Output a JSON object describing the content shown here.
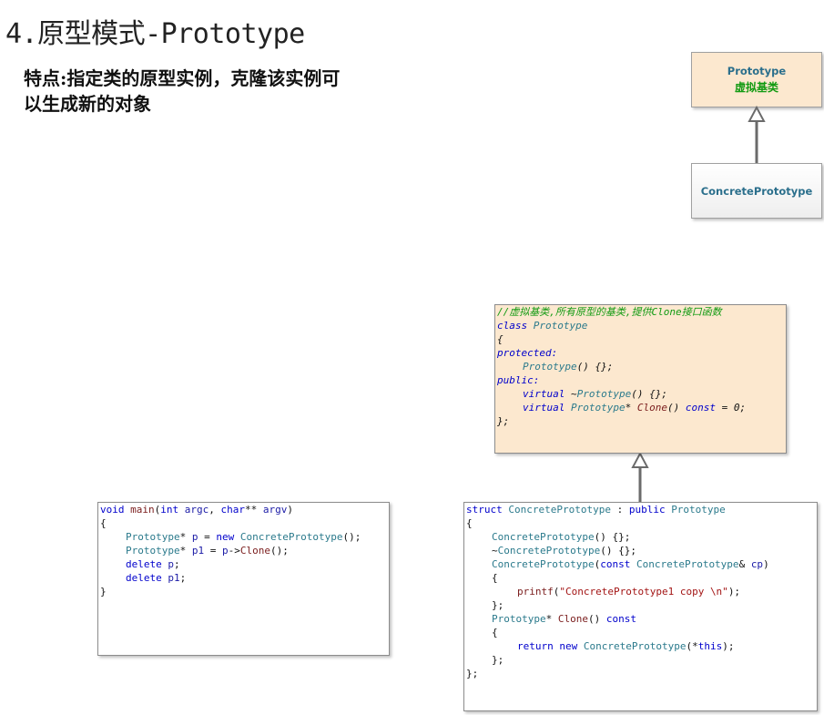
{
  "title": "4.原型模式-Prototype",
  "description": "特点:指定类的原型实例，克隆该实例可以生成新的对象",
  "uml": {
    "prototype": {
      "name": "Prototype",
      "subtitle": "虚拟基类"
    },
    "concrete": {
      "name": "ConcretePrototype"
    }
  },
  "code_declaration": {
    "lines": [
      {
        "tokens": [
          {
            "t": "//虚拟基类,所有原型的基类,提供Clone接口函数",
            "c": "comment"
          }
        ],
        "indent": 0
      },
      {
        "tokens": [
          {
            "t": "class ",
            "c": "kw"
          },
          {
            "t": "Prototype",
            "c": "type"
          }
        ],
        "indent": 0
      },
      {
        "tokens": [
          {
            "t": "{",
            "c": "plain"
          }
        ],
        "indent": 0
      },
      {
        "tokens": [
          {
            "t": "protected:",
            "c": "kw"
          }
        ],
        "indent": 0
      },
      {
        "tokens": [
          {
            "t": "Prototype",
            "c": "type"
          },
          {
            "t": "() {};",
            "c": "plain"
          }
        ],
        "indent": 1
      },
      {
        "tokens": [
          {
            "t": "public:",
            "c": "kw"
          }
        ],
        "indent": 0
      },
      {
        "tokens": [
          {
            "t": "virtual ",
            "c": "kw"
          },
          {
            "t": "~",
            "c": "plain"
          },
          {
            "t": "Prototype",
            "c": "type"
          },
          {
            "t": "() {};",
            "c": "plain"
          }
        ],
        "indent": 1
      },
      {
        "tokens": [
          {
            "t": "virtual ",
            "c": "kw"
          },
          {
            "t": "Prototype",
            "c": "type"
          },
          {
            "t": "* ",
            "c": "plain"
          },
          {
            "t": "Clone",
            "c": "fn"
          },
          {
            "t": "() ",
            "c": "plain"
          },
          {
            "t": "const",
            "c": "kw"
          },
          {
            "t": " = 0;",
            "c": "plain"
          }
        ],
        "indent": 1
      },
      {
        "tokens": [
          {
            "t": "};",
            "c": "plain"
          }
        ],
        "indent": 0
      }
    ]
  },
  "code_implementation": {
    "lines": [
      {
        "tokens": [
          {
            "t": "struct ",
            "c": "kw"
          },
          {
            "t": "ConcretePrototype",
            "c": "type"
          },
          {
            "t": " : ",
            "c": "plain"
          },
          {
            "t": "public ",
            "c": "kw"
          },
          {
            "t": "Prototype",
            "c": "type"
          }
        ],
        "indent": 0
      },
      {
        "tokens": [
          {
            "t": "{",
            "c": "plain"
          }
        ],
        "indent": 0
      },
      {
        "tokens": [
          {
            "t": "ConcretePrototype",
            "c": "type"
          },
          {
            "t": "() {};",
            "c": "plain"
          }
        ],
        "indent": 1
      },
      {
        "tokens": [
          {
            "t": "~",
            "c": "plain"
          },
          {
            "t": "ConcretePrototype",
            "c": "type"
          },
          {
            "t": "() {};",
            "c": "plain"
          }
        ],
        "indent": 1
      },
      {
        "tokens": [
          {
            "t": "ConcretePrototype",
            "c": "type"
          },
          {
            "t": "(",
            "c": "plain"
          },
          {
            "t": "const ",
            "c": "kw"
          },
          {
            "t": "ConcretePrototype",
            "c": "type"
          },
          {
            "t": "& ",
            "c": "plain"
          },
          {
            "t": "cp",
            "c": "blue"
          },
          {
            "t": ")",
            "c": "plain"
          }
        ],
        "indent": 1
      },
      {
        "tokens": [
          {
            "t": "{",
            "c": "plain"
          }
        ],
        "indent": 1
      },
      {
        "tokens": [
          {
            "t": "printf",
            "c": "fn"
          },
          {
            "t": "(",
            "c": "plain"
          },
          {
            "t": "\"ConcretePrototype1 copy \\n\"",
            "c": "str"
          },
          {
            "t": ");",
            "c": "plain"
          }
        ],
        "indent": 2
      },
      {
        "tokens": [
          {
            "t": "};",
            "c": "plain"
          }
        ],
        "indent": 1
      },
      {
        "tokens": [
          {
            "t": "Prototype",
            "c": "type"
          },
          {
            "t": "* ",
            "c": "plain"
          },
          {
            "t": "Clone",
            "c": "fn"
          },
          {
            "t": "() ",
            "c": "plain"
          },
          {
            "t": "const",
            "c": "kw"
          }
        ],
        "indent": 1
      },
      {
        "tokens": [
          {
            "t": "{",
            "c": "plain"
          }
        ],
        "indent": 1
      },
      {
        "tokens": [
          {
            "t": "return ",
            "c": "kw"
          },
          {
            "t": "new ",
            "c": "kw"
          },
          {
            "t": "ConcretePrototype",
            "c": "type"
          },
          {
            "t": "(*",
            "c": "plain"
          },
          {
            "t": "this",
            "c": "kw"
          },
          {
            "t": ");",
            "c": "plain"
          }
        ],
        "indent": 2
      },
      {
        "tokens": [
          {
            "t": "};",
            "c": "plain"
          }
        ],
        "indent": 1
      },
      {
        "tokens": [
          {
            "t": "};",
            "c": "plain"
          }
        ],
        "indent": 0
      }
    ]
  },
  "code_main": {
    "lines": [
      {
        "tokens": [
          {
            "t": "void ",
            "c": "kw"
          },
          {
            "t": "main",
            "c": "fn"
          },
          {
            "t": "(",
            "c": "plain"
          },
          {
            "t": "int ",
            "c": "kw"
          },
          {
            "t": "argc",
            "c": "blue"
          },
          {
            "t": ", ",
            "c": "plain"
          },
          {
            "t": "char",
            "c": "kw"
          },
          {
            "t": "** ",
            "c": "plain"
          },
          {
            "t": "argv",
            "c": "blue"
          },
          {
            "t": ")",
            "c": "plain"
          }
        ],
        "indent": 0
      },
      {
        "tokens": [
          {
            "t": "{",
            "c": "plain"
          }
        ],
        "indent": 0
      },
      {
        "tokens": [
          {
            "t": "Prototype",
            "c": "type"
          },
          {
            "t": "* ",
            "c": "plain"
          },
          {
            "t": "p",
            "c": "blue"
          },
          {
            "t": " = ",
            "c": "plain"
          },
          {
            "t": "new ",
            "c": "kw"
          },
          {
            "t": "ConcretePrototype",
            "c": "type"
          },
          {
            "t": "();",
            "c": "plain"
          }
        ],
        "indent": 1
      },
      {
        "tokens": [
          {
            "t": "Prototype",
            "c": "type"
          },
          {
            "t": "* ",
            "c": "plain"
          },
          {
            "t": "p1",
            "c": "blue"
          },
          {
            "t": " = ",
            "c": "plain"
          },
          {
            "t": "p",
            "c": "blue"
          },
          {
            "t": "->",
            "c": "plain"
          },
          {
            "t": "Clone",
            "c": "fn"
          },
          {
            "t": "();",
            "c": "plain"
          }
        ],
        "indent": 1
      },
      {
        "tokens": [
          {
            "t": "delete ",
            "c": "kw"
          },
          {
            "t": "p",
            "c": "blue"
          },
          {
            "t": ";",
            "c": "plain"
          }
        ],
        "indent": 1
      },
      {
        "tokens": [
          {
            "t": "delete ",
            "c": "kw"
          },
          {
            "t": "p1",
            "c": "blue"
          },
          {
            "t": ";",
            "c": "plain"
          }
        ],
        "indent": 1
      },
      {
        "tokens": [
          {
            "t": "}",
            "c": "plain"
          }
        ],
        "indent": 0
      }
    ]
  }
}
